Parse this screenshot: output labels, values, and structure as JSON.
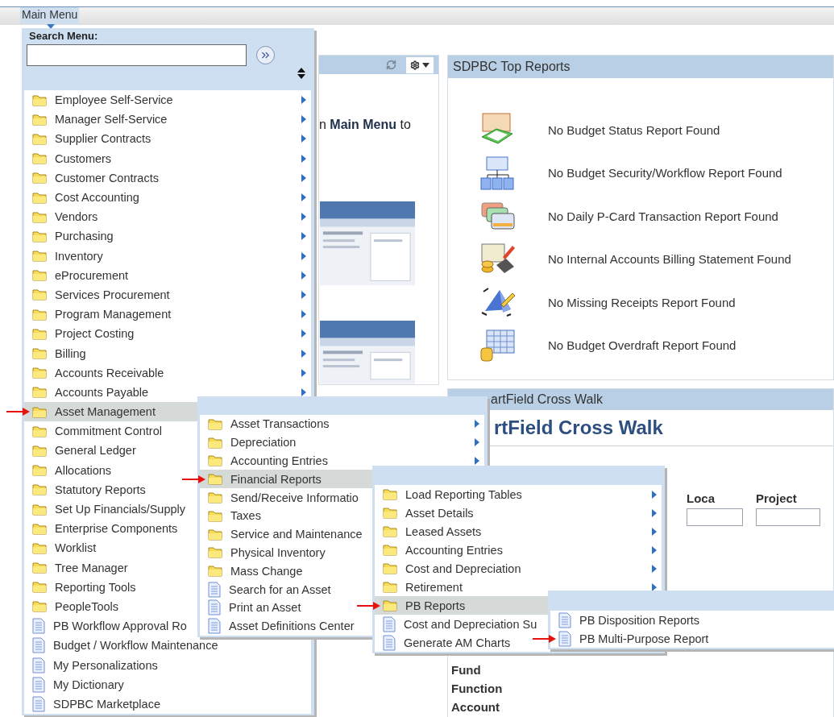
{
  "top_bar": {
    "menu_tab": "Main Menu"
  },
  "main_menu": {
    "search_label": "Search Menu:",
    "items": [
      {
        "label": "Employee Self-Service",
        "kind": "folder",
        "selected": false,
        "arrow": true,
        "pointer": false
      },
      {
        "label": "Manager Self-Service",
        "kind": "folder",
        "selected": false,
        "arrow": true,
        "pointer": false
      },
      {
        "label": "Supplier Contracts",
        "kind": "folder",
        "selected": false,
        "arrow": true,
        "pointer": false
      },
      {
        "label": "Customers",
        "kind": "folder",
        "selected": false,
        "arrow": true,
        "pointer": false
      },
      {
        "label": "Customer Contracts",
        "kind": "folder",
        "selected": false,
        "arrow": true,
        "pointer": false
      },
      {
        "label": "Cost Accounting",
        "kind": "folder",
        "selected": false,
        "arrow": true,
        "pointer": false
      },
      {
        "label": "Vendors",
        "kind": "folder",
        "selected": false,
        "arrow": true,
        "pointer": false
      },
      {
        "label": "Purchasing",
        "kind": "folder",
        "selected": false,
        "arrow": true,
        "pointer": false
      },
      {
        "label": "Inventory",
        "kind": "folder",
        "selected": false,
        "arrow": true,
        "pointer": false
      },
      {
        "label": "eProcurement",
        "kind": "folder",
        "selected": false,
        "arrow": true,
        "pointer": false
      },
      {
        "label": "Services Procurement",
        "kind": "folder",
        "selected": false,
        "arrow": true,
        "pointer": false
      },
      {
        "label": "Program Management",
        "kind": "folder",
        "selected": false,
        "arrow": true,
        "pointer": false
      },
      {
        "label": "Project Costing",
        "kind": "folder",
        "selected": false,
        "arrow": true,
        "pointer": false
      },
      {
        "label": "Billing",
        "kind": "folder",
        "selected": false,
        "arrow": true,
        "pointer": false
      },
      {
        "label": "Accounts Receivable",
        "kind": "folder",
        "selected": false,
        "arrow": true,
        "pointer": false
      },
      {
        "label": "Accounts Payable",
        "kind": "folder",
        "selected": false,
        "arrow": true,
        "pointer": false
      },
      {
        "label": "Asset Management",
        "kind": "folder",
        "selected": true,
        "arrow": false,
        "pointer": true
      },
      {
        "label": "Commitment Control",
        "kind": "folder",
        "selected": false,
        "arrow": false,
        "pointer": false
      },
      {
        "label": "General Ledger",
        "kind": "folder",
        "selected": false,
        "arrow": false,
        "pointer": false
      },
      {
        "label": "Allocations",
        "kind": "folder",
        "selected": false,
        "arrow": false,
        "pointer": false
      },
      {
        "label": "Statutory Reports",
        "kind": "folder",
        "selected": false,
        "arrow": false,
        "pointer": false
      },
      {
        "label": "Set Up Financials/Supply",
        "kind": "folder",
        "selected": false,
        "arrow": false,
        "pointer": false
      },
      {
        "label": "Enterprise Components",
        "kind": "folder",
        "selected": false,
        "arrow": false,
        "pointer": false
      },
      {
        "label": "Worklist",
        "kind": "folder",
        "selected": false,
        "arrow": false,
        "pointer": false
      },
      {
        "label": "Tree Manager",
        "kind": "folder",
        "selected": false,
        "arrow": false,
        "pointer": false
      },
      {
        "label": "Reporting Tools",
        "kind": "folder",
        "selected": false,
        "arrow": false,
        "pointer": false
      },
      {
        "label": "PeopleTools",
        "kind": "folder",
        "selected": false,
        "arrow": false,
        "pointer": false
      },
      {
        "label": "PB Workflow Approval Ro",
        "kind": "page",
        "selected": false,
        "arrow": false,
        "pointer": false
      },
      {
        "label": "Budget / Workflow Maintenance",
        "kind": "page",
        "selected": false,
        "arrow": false,
        "pointer": false
      },
      {
        "label": "My Personalizations",
        "kind": "page",
        "selected": false,
        "arrow": false,
        "pointer": false
      },
      {
        "label": "My Dictionary",
        "kind": "page",
        "selected": false,
        "arrow": false,
        "pointer": false
      },
      {
        "label": "SDPBC Marketplace",
        "kind": "page",
        "selected": false,
        "arrow": false,
        "pointer": false
      }
    ]
  },
  "submenus": [
    {
      "items": [
        {
          "label": "Asset Transactions",
          "kind": "folder",
          "selected": false,
          "arrow": true,
          "pointer": false
        },
        {
          "label": "Depreciation",
          "kind": "folder",
          "selected": false,
          "arrow": true,
          "pointer": false
        },
        {
          "label": "Accounting Entries",
          "kind": "folder",
          "selected": false,
          "arrow": true,
          "pointer": false
        },
        {
          "label": "Financial Reports",
          "kind": "folder",
          "selected": true,
          "arrow": false,
          "pointer": true
        },
        {
          "label": "Send/Receive Informatio",
          "kind": "folder",
          "selected": false,
          "arrow": false,
          "pointer": false
        },
        {
          "label": "Taxes",
          "kind": "folder",
          "selected": false,
          "arrow": false,
          "pointer": false
        },
        {
          "label": "Service and Maintenance",
          "kind": "folder",
          "selected": false,
          "arrow": false,
          "pointer": false
        },
        {
          "label": "Physical Inventory",
          "kind": "folder",
          "selected": false,
          "arrow": false,
          "pointer": false
        },
        {
          "label": "Mass Change",
          "kind": "folder",
          "selected": false,
          "arrow": false,
          "pointer": false
        },
        {
          "label": "Search for an Asset",
          "kind": "page",
          "selected": false,
          "arrow": false,
          "pointer": false
        },
        {
          "label": "Print an Asset",
          "kind": "page",
          "selected": false,
          "arrow": false,
          "pointer": false
        },
        {
          "label": "Asset Definitions Center",
          "kind": "page",
          "selected": false,
          "arrow": false,
          "pointer": false
        }
      ]
    },
    {
      "items": [
        {
          "label": "Load Reporting Tables",
          "kind": "folder",
          "selected": false,
          "arrow": true,
          "pointer": false
        },
        {
          "label": "Asset Details",
          "kind": "folder",
          "selected": false,
          "arrow": true,
          "pointer": false
        },
        {
          "label": "Leased Assets",
          "kind": "folder",
          "selected": false,
          "arrow": true,
          "pointer": false
        },
        {
          "label": "Accounting Entries",
          "kind": "folder",
          "selected": false,
          "arrow": true,
          "pointer": false
        },
        {
          "label": "Cost and Depreciation",
          "kind": "folder",
          "selected": false,
          "arrow": true,
          "pointer": false
        },
        {
          "label": "Retirement",
          "kind": "folder",
          "selected": false,
          "arrow": true,
          "pointer": false
        },
        {
          "label": "PB Reports",
          "kind": "folder",
          "selected": true,
          "arrow": false,
          "pointer": true
        },
        {
          "label": "Cost and Depreciation Su",
          "kind": "page",
          "selected": false,
          "arrow": false,
          "pointer": false
        },
        {
          "label": "Generate AM Charts",
          "kind": "page",
          "selected": false,
          "arrow": false,
          "pointer": false
        }
      ]
    },
    {
      "items": [
        {
          "label": "PB Disposition Reports",
          "kind": "page",
          "selected": false,
          "arrow": false,
          "pointer": false
        },
        {
          "label": "PB Multi-Purpose Report",
          "kind": "page",
          "selected": false,
          "arrow": false,
          "pointer": true
        }
      ]
    }
  ],
  "left_pagelet": {
    "text": "n **Main Menu** to"
  },
  "top_reports": {
    "title": "SDPBC Top Reports",
    "reports": [
      "No Budget Status Report Found",
      "No Budget Security/Workflow Report Found",
      "No Daily P-Card Transaction Report Found",
      "No Internal Accounts Billing Statement Found",
      "No Missing Receipts Report Found",
      "No Budget Overdraft Report Found"
    ]
  },
  "cross_walk": {
    "header": "artField Cross Walk",
    "title": "rtField Cross Walk",
    "field_labels": [
      "Loca",
      "Project"
    ],
    "row_labels": [
      "Fund",
      "Function",
      "Account"
    ]
  }
}
